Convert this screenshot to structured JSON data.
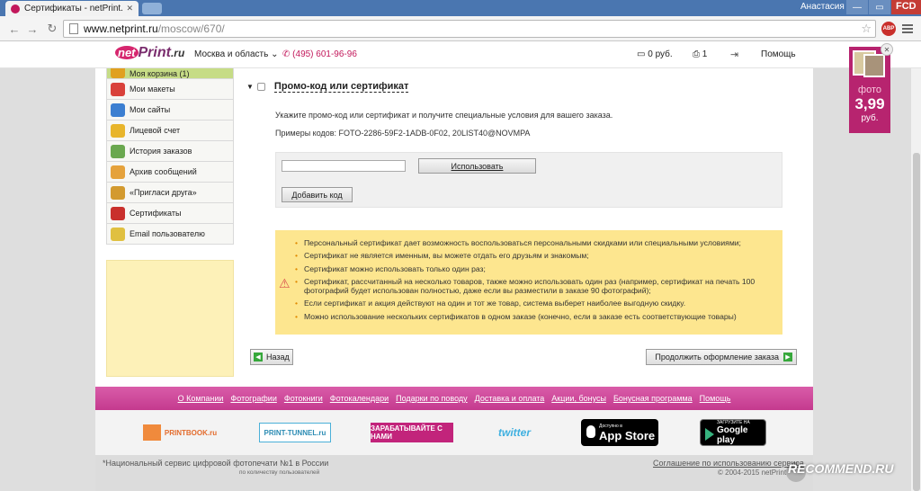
{
  "browser": {
    "tab_title": "Сертификаты - netPrint.r",
    "user_name": "Анастасия",
    "corner_label": "FCD",
    "url_host": "www.netprint.ru",
    "url_path": "/moscow/670/",
    "adblock_label": "ABP"
  },
  "header": {
    "logo_net": "net",
    "logo_print": "Print",
    "logo_ru": ".ru",
    "city": "Москва и область ⌄",
    "phone": "(495) 601-96-96",
    "cart": "0 руб.",
    "print_count": "1",
    "help": "Помощь"
  },
  "sidebar": {
    "items": [
      {
        "label": "Моя корзина (1)",
        "color": "#e0a020"
      },
      {
        "label": "Мои макеты",
        "color": "#d9413a"
      },
      {
        "label": "Мои сайты",
        "color": "#3c7fd1"
      },
      {
        "label": "Лицевой счет",
        "color": "#e8b52b"
      },
      {
        "label": "История заказов",
        "color": "#6aa84f"
      },
      {
        "label": "Архив сообщений",
        "color": "#e5a23c"
      },
      {
        "label": "«Пригласи друга»",
        "color": "#d39a2f"
      },
      {
        "label": "Сертификаты",
        "color": "#c9302c"
      },
      {
        "label": "Email пользователю",
        "color": "#e0c040"
      }
    ]
  },
  "promo_section": {
    "title": "Промо-код или сертификат",
    "description": "Укажите промо-код или сертификат и получите специальные условия для вашего заказа.",
    "examples": "Примеры кодов: FOTO-2286-59F2-1ADB-0F02, 20LIST40@NOVMPA",
    "code_value": "",
    "use_button": "Использовать",
    "add_button": "Добавить код"
  },
  "notice": {
    "items": [
      "Персональный сертификат дает возможность воспользоваться персональными скидками или специальными условиями;",
      "Сертификат не является именным, вы можете отдать его друзьям и знакомым;",
      "Сертификат можно использовать только один раз;",
      "Сертификат, рассчитанный на несколько товаров, также можно использовать один раз (например, сертификат на печать 100 фотографий будет использован полностью, даже если вы разместили в заказе 90 фотографий);",
      "Если сертификат и акция действуют на один и тот же товар, система выберет наиболее выгодную скидку.",
      "Можно использование нескольких сертификатов в одном заказе (конечно, если в заказе есть соответствующие товары)"
    ]
  },
  "actions": {
    "back": "Назад",
    "continue": "Продолжить оформление заказа"
  },
  "photo_promo": {
    "label": "фото",
    "price": "3,99",
    "unit": "руб."
  },
  "footer": {
    "links": [
      "О Компании",
      "Фотографии",
      "Фотокниги",
      "Фотокалендари",
      "Подарки по поводу",
      "Доставка и оплата",
      "Акции, бонусы",
      "Бонусная программа",
      "Помощь"
    ],
    "partners": {
      "printbook": "PRINTBOOK.ru",
      "tunnel": "PRINT-TUNNEL.ru",
      "earn": "ЗАРАБАТЫВАЙТЕ С НАМИ",
      "twitter": "twitter",
      "appstore_small": "Доступно в",
      "appstore_big": "App Store",
      "gplay_small": "ЗАГРУЗИТЕ НА",
      "gplay_big": "Google play"
    },
    "slogan": "*Национальный сервис цифровой фотопечати №1 в России",
    "slogan_sub": "по количеству пользователей",
    "terms": "Соглашение по использованию сервиса",
    "copyright": "© 2004-2015 netPrint"
  },
  "watermark": "RECOMMEND.RU"
}
